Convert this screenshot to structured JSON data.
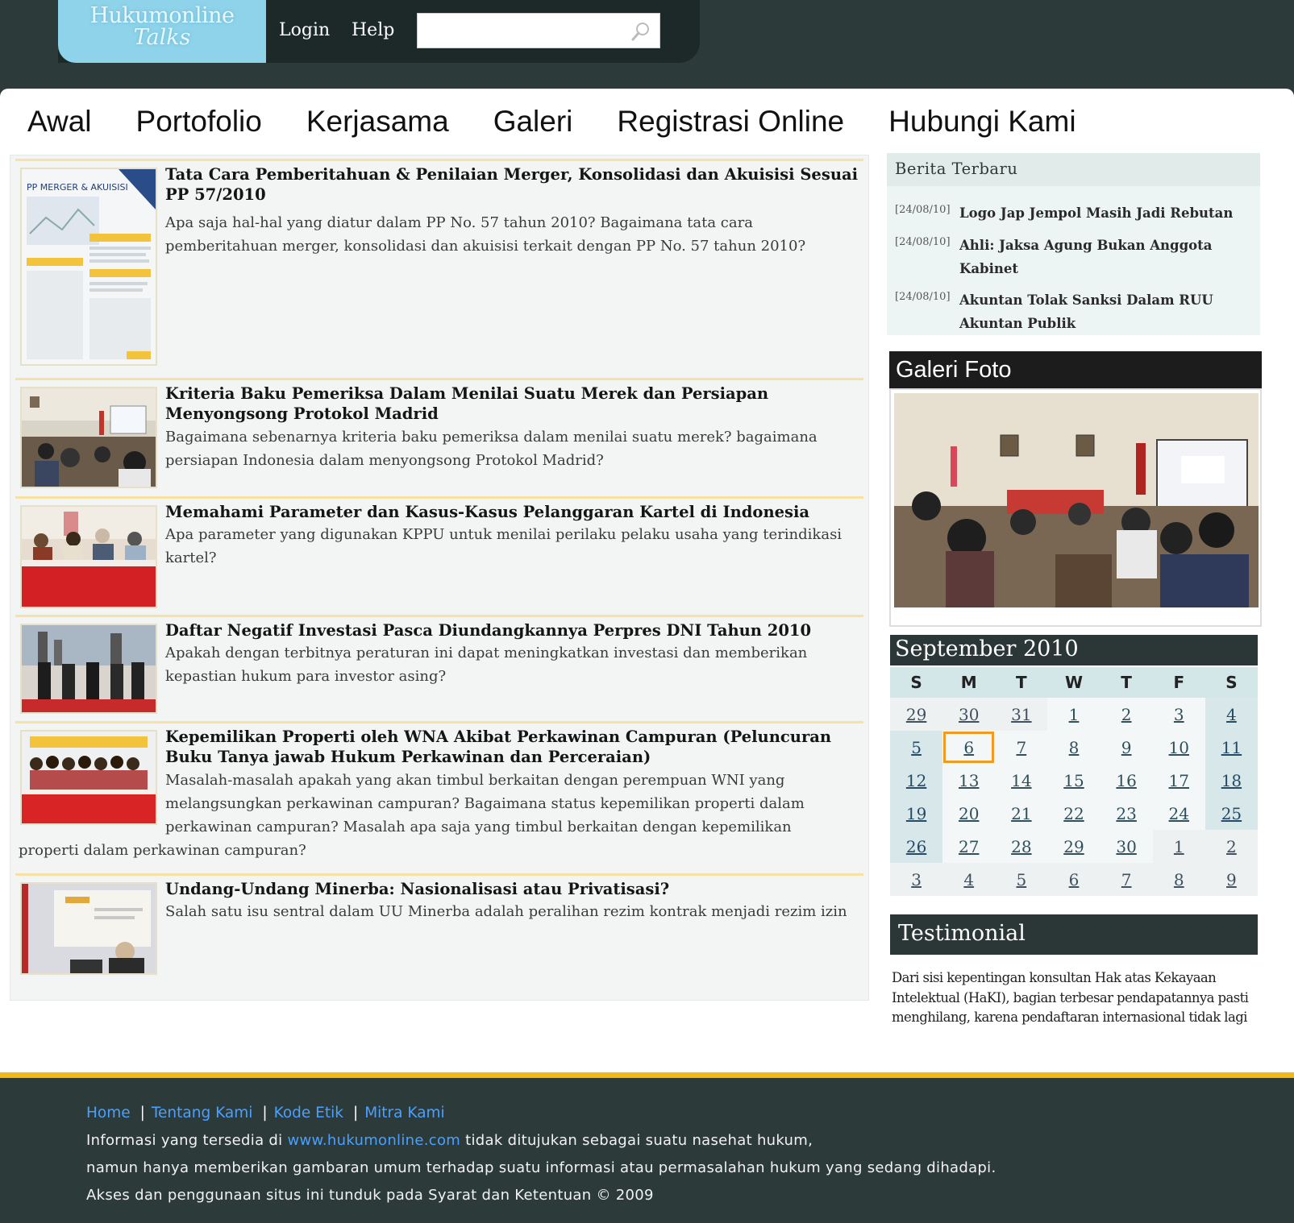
{
  "header": {
    "logo_line1": "Hukumonline",
    "logo_line2": "Talks",
    "login": "Login",
    "help": "Help",
    "search_placeholder": ""
  },
  "nav": [
    "Awal",
    "Portofolio",
    "Kerjasama",
    "Galeri",
    "Registrasi Online",
    "Hubungi Kami"
  ],
  "articles": [
    {
      "title": "Tata Cara Pemberitahuan & Penilaian Merger, Konsolidasi dan Akuisisi Sesuai PP 57/2010",
      "desc": "Apa saja hal-hal yang diatur dalam PP No. 57 tahun 2010? Bagaimana tata cara pemberitahuan merger, konsolidasi dan akuisisi terkait dengan PP No. 57 tahun 2010?",
      "thumb_text": "PP MERGER & AKUISISI"
    },
    {
      "title": "Kriteria Baku Pemeriksa Dalam Menilai Suatu Merek dan Persiapan Menyongsong Protokol Madrid",
      "desc": "Bagaimana sebenarnya kriteria baku pemeriksa dalam menilai suatu merek? bagaimana persiapan Indonesia dalam menyongsong Protokol Madrid?"
    },
    {
      "title": "Memahami Parameter dan Kasus-Kasus Pelanggaran Kartel di Indonesia",
      "desc": "Apa parameter yang digunakan KPPU untuk menilai perilaku pelaku usaha yang terindikasi kartel?"
    },
    {
      "title": "Daftar Negatif Investasi Pasca Diundangkannya Perpres DNI Tahun 2010",
      "desc": "Apakah dengan terbitnya peraturan ini dapat meningkatkan investasi dan memberikan kepastian hukum para investor asing?"
    },
    {
      "title": "Kepemilikan Properti oleh WNA Akibat Perkawinan Campuran (Peluncuran Buku Tanya jawab Hukum Perkawinan dan Perceraian)",
      "desc": "Masalah-masalah apakah yang akan timbul berkaitan dengan perempuan WNI yang melangsungkan perkawinan campuran? Bagaimana status kepemilikan properti dalam perkawinan campuran? Masalah apa saja yang timbul berkaitan dengan kepemilikan",
      "desc_tail": "properti dalam perkawinan campuran?"
    },
    {
      "title": "Undang-Undang Minerba: Nasionalisasi atau Privatisasi?",
      "desc": "Salah satu isu sentral dalam UU Minerba adalah peralihan rezim kontrak menjadi rezim izin"
    }
  ],
  "berita": {
    "heading": "Berita Terbaru",
    "items": [
      {
        "date": "[24/08/10]",
        "headline": "Logo Jap Jempol Masih Jadi Rebutan"
      },
      {
        "date": "[24/08/10]",
        "headline": "Ahli: Jaksa Agung Bukan Anggota Kabinet"
      },
      {
        "date": "[24/08/10]",
        "headline": "Akuntan Tolak Sanksi Dalam RUU Akuntan Publik"
      }
    ]
  },
  "galeri": {
    "heading": "Galeri Foto"
  },
  "calendar": {
    "month": "September 2010",
    "days": [
      "S",
      "M",
      "T",
      "W",
      "T",
      "F",
      "S"
    ],
    "weeks": [
      [
        "29",
        "30",
        "31",
        "1",
        "2",
        "3",
        "4"
      ],
      [
        "5",
        "6",
        "7",
        "8",
        "9",
        "10",
        "11"
      ],
      [
        "12",
        "13",
        "14",
        "15",
        "16",
        "17",
        "18"
      ],
      [
        "19",
        "20",
        "21",
        "22",
        "23",
        "24",
        "25"
      ],
      [
        "26",
        "27",
        "28",
        "29",
        "30",
        "1",
        "2"
      ],
      [
        "3",
        "4",
        "5",
        "6",
        "7",
        "8",
        "9"
      ]
    ],
    "today": "6"
  },
  "testimonial": {
    "heading": "Testimonial",
    "text": "Dari sisi kepentingan konsultan Hak atas Kekayaan Intelektual (HaKI), bagian terbesar pendapatannya pasti menghilang, karena pendaftaran internasional tidak lagi"
  },
  "footer": {
    "links": [
      "Home",
      "Tentang Kami",
      "Kode Etik",
      "Mitra Kami"
    ],
    "line1_pre": "Informasi yang tersedia di ",
    "line1_link": "www.hukumonline.com",
    "line1_post": " tidak ditujukan sebagai suatu nasehat hukum,",
    "line2": "namun hanya memberikan gambaran umum terhadap suatu informasi atau permasalahan hukum yang sedang dihadapi.",
    "line3": "Akses dan penggunaan situs ini tunduk pada Syarat dan Ketentuan © 2009"
  },
  "colors": {
    "dark_bg": "#2d3a3a",
    "logo_blue": "#8fd3ea",
    "footer_accent": "#f1b818",
    "link_blue": "#4aa0ff",
    "today_outline": "#f09a20"
  }
}
